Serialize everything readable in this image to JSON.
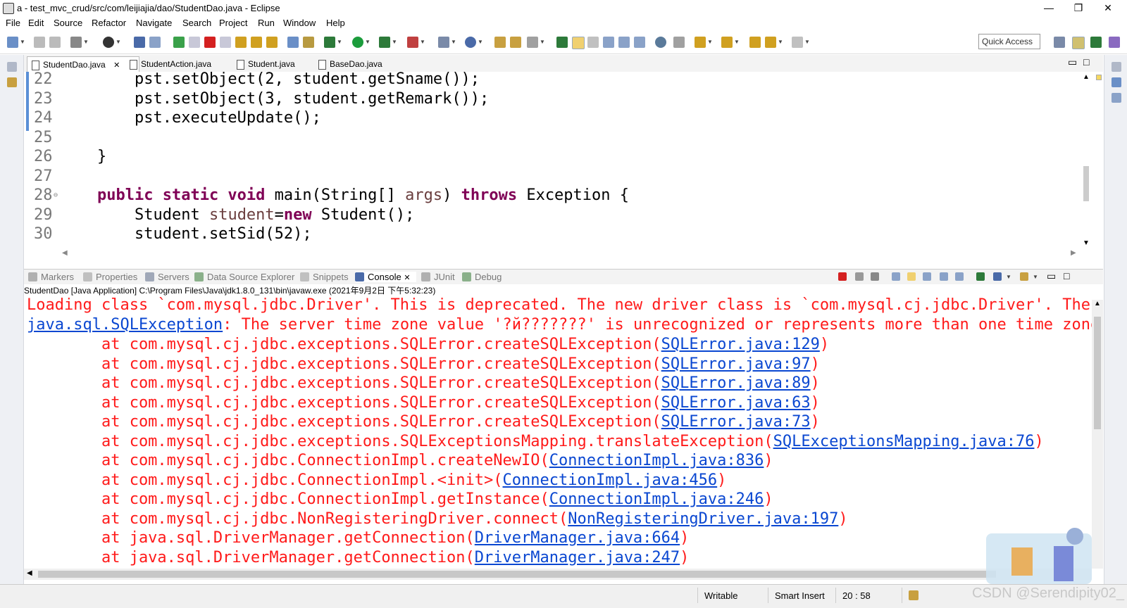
{
  "window": {
    "title": "a - test_mvc_crud/src/com/leijiajia/dao/StudentDao.java - Eclipse",
    "controls": [
      "—",
      "❐",
      "✕"
    ]
  },
  "menu": [
    "File",
    "Edit",
    "Source",
    "Refactor",
    "Navigate",
    "Search",
    "Project",
    "Run",
    "Window",
    "Help"
  ],
  "toolbar": {
    "quick_access": "Quick Access"
  },
  "editor": {
    "tabs": [
      {
        "label": "StudentDao.java",
        "close": "✕"
      },
      {
        "label": "StudentAction.java"
      },
      {
        "label": "Student.java"
      },
      {
        "label": "BaseDao.java"
      }
    ],
    "lines": [
      {
        "num": "22",
        "text": "    pst.setObject(2, student.getSname());"
      },
      {
        "num": "23",
        "text": "    pst.setObject(3, student.getRemark());"
      },
      {
        "num": "24",
        "text": "    pst.executeUpdate();"
      },
      {
        "num": "25",
        "text": ""
      },
      {
        "num": "26",
        "text": "}"
      },
      {
        "num": "27",
        "text": ""
      },
      {
        "num": "28",
        "text": ""
      },
      {
        "num": "29",
        "text": ""
      },
      {
        "num": "30",
        "text": "    student.setSid(52);"
      }
    ],
    "line28": {
      "kw1": "public static void",
      "mid": " main(String[] ",
      "var": "args",
      "mid2": ") ",
      "kw2": "throws",
      "end": " Exception {"
    },
    "line29": {
      "pre": "    Student ",
      "var": "student",
      "eq": "=",
      "kw": "new",
      "end": " Student();"
    }
  },
  "console": {
    "tabs": [
      "Markers",
      "Properties",
      "Servers",
      "Data Source Explorer",
      "Snippets",
      "Console",
      "JUnit",
      "Debug"
    ],
    "header": "StudentDao [Java Application] C:\\Program Files\\Java\\jdk1.8.0_131\\bin\\javaw.exe (2021年9月2日 下午5:32:23)",
    "line1": "Loading class `com.mysql.jdbc.Driver'. This is deprecated. The new driver class is `com.mysql.cj.jdbc.Driver'. The d",
    "line2_link": "java.sql.SQLException",
    "line2_rest": ": The server time zone value '?й???????' is unrecognized or represents more than one time zone.",
    "stack": [
      {
        "pre": "        at com.mysql.cj.jdbc.exceptions.SQLError.createSQLException(",
        "link": "SQLError.java:129",
        "post": ")"
      },
      {
        "pre": "        at com.mysql.cj.jdbc.exceptions.SQLError.createSQLException(",
        "link": "SQLError.java:97",
        "post": ")"
      },
      {
        "pre": "        at com.mysql.cj.jdbc.exceptions.SQLError.createSQLException(",
        "link": "SQLError.java:89",
        "post": ")"
      },
      {
        "pre": "        at com.mysql.cj.jdbc.exceptions.SQLError.createSQLException(",
        "link": "SQLError.java:63",
        "post": ")"
      },
      {
        "pre": "        at com.mysql.cj.jdbc.exceptions.SQLError.createSQLException(",
        "link": "SQLError.java:73",
        "post": ")"
      },
      {
        "pre": "        at com.mysql.cj.jdbc.exceptions.SQLExceptionsMapping.translateException(",
        "link": "SQLExceptionsMapping.java:76",
        "post": ")"
      },
      {
        "pre": "        at com.mysql.cj.jdbc.ConnectionImpl.createNewIO(",
        "link": "ConnectionImpl.java:836",
        "post": ")"
      },
      {
        "pre": "        at com.mysql.cj.jdbc.ConnectionImpl.<init>(",
        "link": "ConnectionImpl.java:456",
        "post": ")"
      },
      {
        "pre": "        at com.mysql.cj.jdbc.ConnectionImpl.getInstance(",
        "link": "ConnectionImpl.java:246",
        "post": ")"
      },
      {
        "pre": "        at com.mysql.cj.jdbc.NonRegisteringDriver.connect(",
        "link": "NonRegisteringDriver.java:197",
        "post": ")"
      },
      {
        "pre": "        at java.sql.DriverManager.getConnection(",
        "link": "DriverManager.java:664",
        "post": ")"
      },
      {
        "pre": "        at java.sql.DriverManager.getConnection(",
        "link": "DriverManager.java:247",
        "post": ")"
      }
    ]
  },
  "status": {
    "writable": "Writable",
    "insert": "Smart Insert",
    "position": "20 : 58"
  },
  "watermark": "CSDN @Serendipity02_",
  "colors": {
    "error_red": "#ff1a1a",
    "link_blue": "#0a47d1",
    "keyword": "#7f0055"
  }
}
